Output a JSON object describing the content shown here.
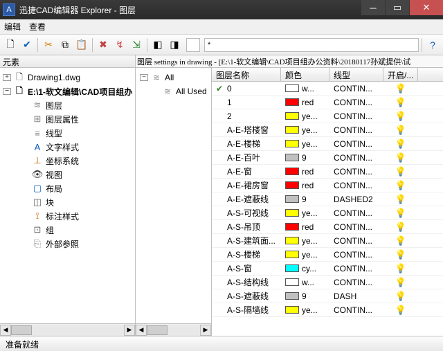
{
  "window": {
    "title": "迅捷CAD编辑器 Explorer - 图层"
  },
  "menu": {
    "edit": "编辑",
    "view": "查看"
  },
  "panels": {
    "elements": "元素"
  },
  "pathbar": "图层 settings in drawing - [E:\\1-软文编辑\\CAD项目组办公资料\\20180117孙斌提供\\试",
  "tree": {
    "root1": "Drawing1.dwg",
    "root2": "E:\\1-软文编辑\\CAD项目组办",
    "items": [
      {
        "label": "图层"
      },
      {
        "label": "图层属性"
      },
      {
        "label": "线型"
      },
      {
        "label": "文字样式"
      },
      {
        "label": "坐标系统"
      },
      {
        "label": "视图"
      },
      {
        "label": "布局"
      },
      {
        "label": "块"
      },
      {
        "label": "标注样式"
      },
      {
        "label": "组"
      },
      {
        "label": "外部参照"
      }
    ]
  },
  "midtree": {
    "all": "All",
    "allused": "All Used"
  },
  "grid": {
    "headers": {
      "name": "图层名称",
      "color": "颜色",
      "linetype": "线型",
      "on": "开启/..."
    },
    "rows": [
      {
        "chk": true,
        "name": "0",
        "swatch": "#ffffff",
        "cname": "w...",
        "lt": "CONTIN...",
        "on": true
      },
      {
        "chk": false,
        "name": "1",
        "swatch": "#ff0000",
        "cname": "red",
        "lt": "CONTIN...",
        "on": true
      },
      {
        "chk": false,
        "name": "2",
        "swatch": "#ffff00",
        "cname": "ye...",
        "lt": "CONTIN...",
        "on": true
      },
      {
        "chk": false,
        "name": "A-E-塔楼窗",
        "swatch": "#ffff00",
        "cname": "ye...",
        "lt": "CONTIN...",
        "on": true
      },
      {
        "chk": false,
        "name": "A-E-楼梯",
        "swatch": "#ffff00",
        "cname": "ye...",
        "lt": "CONTIN...",
        "on": true
      },
      {
        "chk": false,
        "name": "A-E-百叶",
        "swatch": "#c0c0c0",
        "cname": "9",
        "lt": "CONTIN...",
        "on": true
      },
      {
        "chk": false,
        "name": "A-E-窗",
        "swatch": "#ff0000",
        "cname": "red",
        "lt": "CONTIN...",
        "on": true
      },
      {
        "chk": false,
        "name": "A-E-裙房窗",
        "swatch": "#ff0000",
        "cname": "red",
        "lt": "CONTIN...",
        "on": true
      },
      {
        "chk": false,
        "name": "A-E-遮蔽线",
        "swatch": "#c0c0c0",
        "cname": "9",
        "lt": "DASHED2",
        "on": true
      },
      {
        "chk": false,
        "name": "A-S-可视线",
        "swatch": "#ffff00",
        "cname": "ye...",
        "lt": "CONTIN...",
        "on": true
      },
      {
        "chk": false,
        "name": "A-S-吊顶",
        "swatch": "#ff0000",
        "cname": "red",
        "lt": "CONTIN...",
        "on": true
      },
      {
        "chk": false,
        "name": "A-S-建筑面...",
        "swatch": "#ffff00",
        "cname": "ye...",
        "lt": "CONTIN...",
        "on": true
      },
      {
        "chk": false,
        "name": "A-S-楼梯",
        "swatch": "#ffff00",
        "cname": "ye...",
        "lt": "CONTIN...",
        "on": true
      },
      {
        "chk": false,
        "name": "A-S-窗",
        "swatch": "#00ffff",
        "cname": "cy...",
        "lt": "CONTIN...",
        "on": true
      },
      {
        "chk": false,
        "name": "A-S-结构线",
        "swatch": "#ffffff",
        "cname": "w...",
        "lt": "CONTIN...",
        "on": true
      },
      {
        "chk": false,
        "name": "A-S-遮蔽线",
        "swatch": "#c0c0c0",
        "cname": "9",
        "lt": "DASH",
        "on": true
      },
      {
        "chk": false,
        "name": "A-S-隔墙线",
        "swatch": "#ffff00",
        "cname": "ye...",
        "lt": "CONTIN...",
        "on": true
      }
    ]
  },
  "status": "准备就绪"
}
